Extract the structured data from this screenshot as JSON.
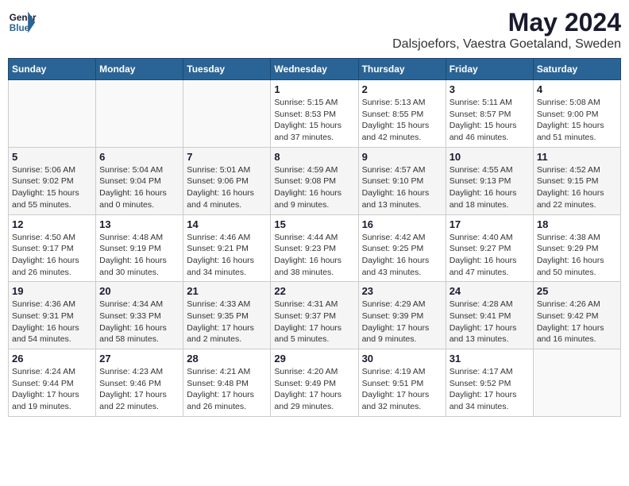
{
  "header": {
    "logo_line1": "General",
    "logo_line2": "Blue",
    "month": "May 2024",
    "location": "Dalsjoefors, Vaestra Goetaland, Sweden"
  },
  "weekdays": [
    "Sunday",
    "Monday",
    "Tuesday",
    "Wednesday",
    "Thursday",
    "Friday",
    "Saturday"
  ],
  "weeks": [
    [
      {
        "day": "",
        "info": ""
      },
      {
        "day": "",
        "info": ""
      },
      {
        "day": "",
        "info": ""
      },
      {
        "day": "1",
        "info": "Sunrise: 5:15 AM\nSunset: 8:53 PM\nDaylight: 15 hours\nand 37 minutes."
      },
      {
        "day": "2",
        "info": "Sunrise: 5:13 AM\nSunset: 8:55 PM\nDaylight: 15 hours\nand 42 minutes."
      },
      {
        "day": "3",
        "info": "Sunrise: 5:11 AM\nSunset: 8:57 PM\nDaylight: 15 hours\nand 46 minutes."
      },
      {
        "day": "4",
        "info": "Sunrise: 5:08 AM\nSunset: 9:00 PM\nDaylight: 15 hours\nand 51 minutes."
      }
    ],
    [
      {
        "day": "5",
        "info": "Sunrise: 5:06 AM\nSunset: 9:02 PM\nDaylight: 15 hours\nand 55 minutes."
      },
      {
        "day": "6",
        "info": "Sunrise: 5:04 AM\nSunset: 9:04 PM\nDaylight: 16 hours\nand 0 minutes."
      },
      {
        "day": "7",
        "info": "Sunrise: 5:01 AM\nSunset: 9:06 PM\nDaylight: 16 hours\nand 4 minutes."
      },
      {
        "day": "8",
        "info": "Sunrise: 4:59 AM\nSunset: 9:08 PM\nDaylight: 16 hours\nand 9 minutes."
      },
      {
        "day": "9",
        "info": "Sunrise: 4:57 AM\nSunset: 9:10 PM\nDaylight: 16 hours\nand 13 minutes."
      },
      {
        "day": "10",
        "info": "Sunrise: 4:55 AM\nSunset: 9:13 PM\nDaylight: 16 hours\nand 18 minutes."
      },
      {
        "day": "11",
        "info": "Sunrise: 4:52 AM\nSunset: 9:15 PM\nDaylight: 16 hours\nand 22 minutes."
      }
    ],
    [
      {
        "day": "12",
        "info": "Sunrise: 4:50 AM\nSunset: 9:17 PM\nDaylight: 16 hours\nand 26 minutes."
      },
      {
        "day": "13",
        "info": "Sunrise: 4:48 AM\nSunset: 9:19 PM\nDaylight: 16 hours\nand 30 minutes."
      },
      {
        "day": "14",
        "info": "Sunrise: 4:46 AM\nSunset: 9:21 PM\nDaylight: 16 hours\nand 34 minutes."
      },
      {
        "day": "15",
        "info": "Sunrise: 4:44 AM\nSunset: 9:23 PM\nDaylight: 16 hours\nand 38 minutes."
      },
      {
        "day": "16",
        "info": "Sunrise: 4:42 AM\nSunset: 9:25 PM\nDaylight: 16 hours\nand 43 minutes."
      },
      {
        "day": "17",
        "info": "Sunrise: 4:40 AM\nSunset: 9:27 PM\nDaylight: 16 hours\nand 47 minutes."
      },
      {
        "day": "18",
        "info": "Sunrise: 4:38 AM\nSunset: 9:29 PM\nDaylight: 16 hours\nand 50 minutes."
      }
    ],
    [
      {
        "day": "19",
        "info": "Sunrise: 4:36 AM\nSunset: 9:31 PM\nDaylight: 16 hours\nand 54 minutes."
      },
      {
        "day": "20",
        "info": "Sunrise: 4:34 AM\nSunset: 9:33 PM\nDaylight: 16 hours\nand 58 minutes."
      },
      {
        "day": "21",
        "info": "Sunrise: 4:33 AM\nSunset: 9:35 PM\nDaylight: 17 hours\nand 2 minutes."
      },
      {
        "day": "22",
        "info": "Sunrise: 4:31 AM\nSunset: 9:37 PM\nDaylight: 17 hours\nand 5 minutes."
      },
      {
        "day": "23",
        "info": "Sunrise: 4:29 AM\nSunset: 9:39 PM\nDaylight: 17 hours\nand 9 minutes."
      },
      {
        "day": "24",
        "info": "Sunrise: 4:28 AM\nSunset: 9:41 PM\nDaylight: 17 hours\nand 13 minutes."
      },
      {
        "day": "25",
        "info": "Sunrise: 4:26 AM\nSunset: 9:42 PM\nDaylight: 17 hours\nand 16 minutes."
      }
    ],
    [
      {
        "day": "26",
        "info": "Sunrise: 4:24 AM\nSunset: 9:44 PM\nDaylight: 17 hours\nand 19 minutes."
      },
      {
        "day": "27",
        "info": "Sunrise: 4:23 AM\nSunset: 9:46 PM\nDaylight: 17 hours\nand 22 minutes."
      },
      {
        "day": "28",
        "info": "Sunrise: 4:21 AM\nSunset: 9:48 PM\nDaylight: 17 hours\nand 26 minutes."
      },
      {
        "day": "29",
        "info": "Sunrise: 4:20 AM\nSunset: 9:49 PM\nDaylight: 17 hours\nand 29 minutes."
      },
      {
        "day": "30",
        "info": "Sunrise: 4:19 AM\nSunset: 9:51 PM\nDaylight: 17 hours\nand 32 minutes."
      },
      {
        "day": "31",
        "info": "Sunrise: 4:17 AM\nSunset: 9:52 PM\nDaylight: 17 hours\nand 34 minutes."
      },
      {
        "day": "",
        "info": ""
      }
    ]
  ]
}
